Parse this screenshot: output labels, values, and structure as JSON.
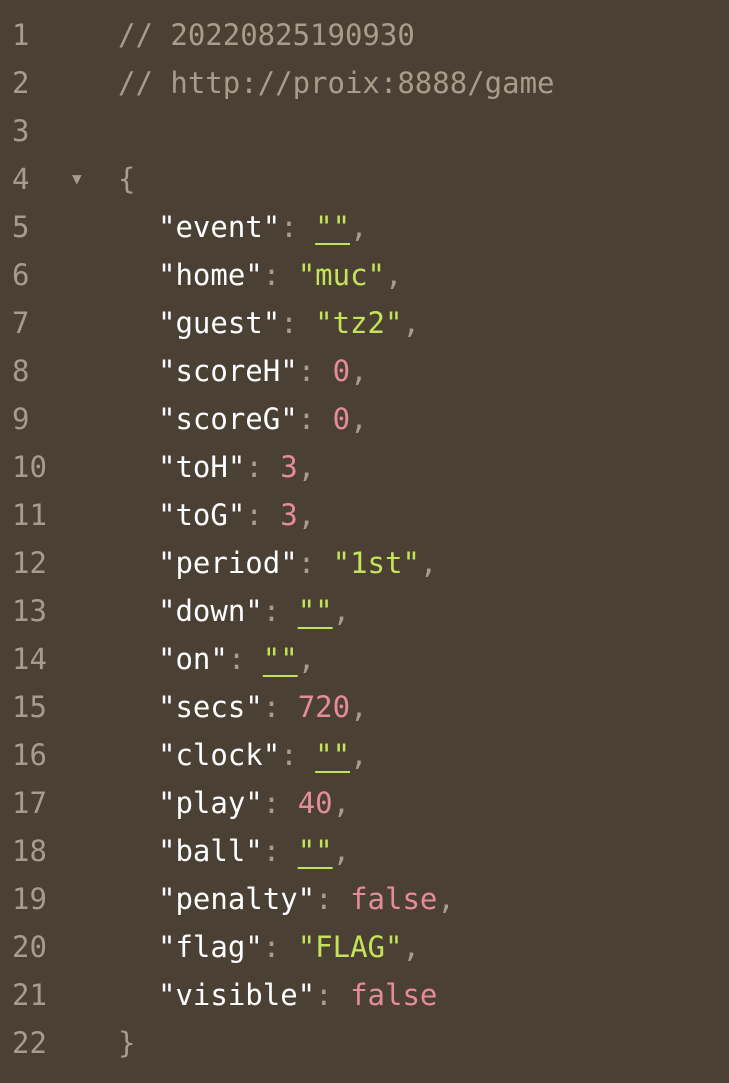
{
  "lines": [
    {
      "n": "1",
      "comment": "// 20220825190930"
    },
    {
      "n": "2",
      "comment": "// http://proix:8888/game"
    },
    {
      "n": "3"
    },
    {
      "n": "4",
      "fold": "▼",
      "open": "{"
    },
    {
      "n": "5",
      "key": "\"event\"",
      "colon": ": ",
      "value": "\"\"",
      "comma": ","
    },
    {
      "n": "6",
      "key": "\"home\"",
      "colon": ": ",
      "value": "\"muc\"",
      "comma": ","
    },
    {
      "n": "7",
      "key": "\"guest\"",
      "colon": ": ",
      "value": "\"tz2\"",
      "comma": ","
    },
    {
      "n": "8",
      "key": "\"scoreH\"",
      "colon": ": ",
      "value": "0",
      "comma": ","
    },
    {
      "n": "9",
      "key": "\"scoreG\"",
      "colon": ": ",
      "value": "0",
      "comma": ","
    },
    {
      "n": "10",
      "key": "\"toH\"",
      "colon": ": ",
      "value": "3",
      "comma": ","
    },
    {
      "n": "11",
      "key": "\"toG\"",
      "colon": ": ",
      "value": "3",
      "comma": ","
    },
    {
      "n": "12",
      "key": "\"period\"",
      "colon": ": ",
      "value": "\"1st\"",
      "comma": ","
    },
    {
      "n": "13",
      "key": "\"down\"",
      "colon": ": ",
      "value": "\"\"",
      "comma": ","
    },
    {
      "n": "14",
      "key": "\"on\"",
      "colon": ": ",
      "value": "\"\"",
      "comma": ","
    },
    {
      "n": "15",
      "key": "\"secs\"",
      "colon": ": ",
      "value": "720",
      "comma": ","
    },
    {
      "n": "16",
      "key": "\"clock\"",
      "colon": ": ",
      "value": "\"\"",
      "comma": ","
    },
    {
      "n": "17",
      "key": "\"play\"",
      "colon": ": ",
      "value": "40",
      "comma": ","
    },
    {
      "n": "18",
      "key": "\"ball\"",
      "colon": ": ",
      "value": "\"\"",
      "comma": ","
    },
    {
      "n": "19",
      "key": "\"penalty\"",
      "colon": ": ",
      "value": "false",
      "comma": ","
    },
    {
      "n": "20",
      "key": "\"flag\"",
      "colon": ": ",
      "value": "\"FLAG\"",
      "comma": ","
    },
    {
      "n": "21",
      "key": "\"visible\"",
      "colon": ": ",
      "value": "false"
    },
    {
      "n": "22",
      "close": "}"
    }
  ],
  "colors": {
    "background": "#4a4034",
    "string": "#c5e35a",
    "number": "#e58c9b",
    "key": "#ffffff",
    "comment": "#a79d8a"
  }
}
